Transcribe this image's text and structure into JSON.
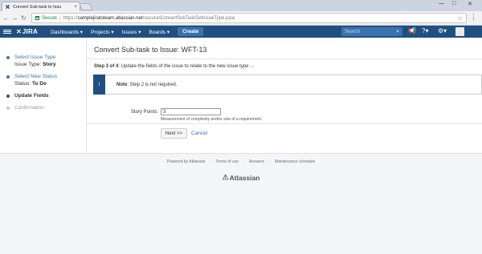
{
  "browser": {
    "tab_title": "Convert Sub-task to Issu",
    "tab_close": "×",
    "secure_label": "Secure",
    "url_scheme": "https://",
    "url_host": "samplejiratolearn.atlassian.net",
    "url_path": "/secure/ConvertSubTaskSetIssueType.jspa",
    "window_controls": [
      "—",
      "□",
      "✕"
    ]
  },
  "header": {
    "logo": "JIRA",
    "nav": [
      "Dashboards ▾",
      "Projects ▾",
      "Issues ▾",
      "Boards ▾"
    ],
    "create_label": "Create",
    "search_placeholder": "Search",
    "colors": {
      "header_bg": "#205081",
      "accent": "#3b73af"
    }
  },
  "steps": [
    {
      "label": "Select Issue Type",
      "detail_key": "Issue Type:",
      "detail_value": "Story",
      "state": "done"
    },
    {
      "label": "Select New Status",
      "detail_key": "Status:",
      "detail_value": "To Do",
      "state": "done"
    },
    {
      "label": "Update Fields",
      "state": "current"
    },
    {
      "label": "Confirmation",
      "state": "future"
    }
  ],
  "main": {
    "title": "Convert Sub-task to Issue: WFT-13",
    "step_prefix": "Step 3 of 4",
    "step_text": ": Update the fields of the issue to relate to the new issue type ...",
    "notice_prefix": "Note",
    "notice_text": ": Step 2 is not required.",
    "notice_icon": "i",
    "field_label": "Story Points:",
    "field_value": "3",
    "field_desc": "Measurement of complexity and/or size of a requirement.",
    "next_label": "Next >>",
    "cancel_label": "Cancel"
  },
  "footer": {
    "links": [
      "Powered by Atlassian",
      "Terms of use",
      "Answers",
      "Maintenance schedule"
    ],
    "brand": "Atlassian"
  }
}
